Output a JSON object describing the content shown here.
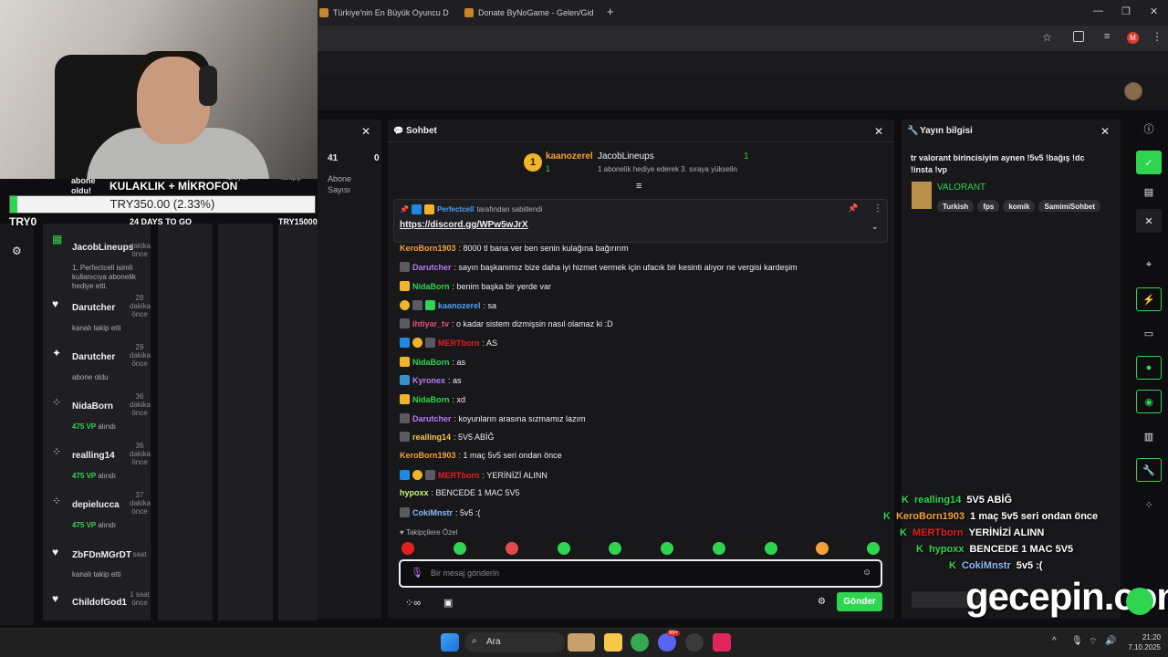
{
  "browser": {
    "tabs": [
      {
        "label": "Türkiye'nin En Büyük Oyuncu D"
      },
      {
        "label": "Donate ByNoGame - Gelen/Gid"
      }
    ],
    "new_tab": "+"
  },
  "dashboard": {
    "stats_count_1": "41",
    "stats_label_1": "Abone Sayısı",
    "stats_count_2": "0",
    "col_label_1": "İzleyici",
    "col_label_2": "Takipçi",
    "abone_oldu": "abone oldu!",
    "try_goal": "TRY15000",
    "goal_title": "KULAKLIK + MİKROFON",
    "goal_amount": "TRY350.00 (2.33%)",
    "goal_left": "TRY0",
    "goal_days": "24 DAYS TO GO",
    "goal_progress": 0.0233
  },
  "activity_feed": [
    {
      "name": "JacobLineups",
      "time": "dakika önce",
      "sub": "1, Perfectcell isimli kullanıcıya abonelik hediye etti."
    },
    {
      "name": "Darutcher",
      "time": "28 dakika önce",
      "sub": "kanalı takip etti"
    },
    {
      "name": "Darutcher",
      "time": "29 dakika önce",
      "sub": "abone oldu"
    },
    {
      "name": "NidaBorn",
      "time": "36 dakika önce",
      "vp": "475 VP",
      "vp_suffix": "alındı"
    },
    {
      "name": "realling14",
      "time": "36 dakika önce",
      "vp": "475 VP",
      "vp_suffix": "alındı"
    },
    {
      "name": "depielucca",
      "time": "37 dakika önce",
      "vp": "475 VP",
      "vp_suffix": "alındı"
    },
    {
      "name": "ZbFDnMGrDT",
      "time": "saat",
      "sub": "kanalı takip etti"
    },
    {
      "name": "ChildofGod1",
      "time": "1 saat önce",
      "sub": ""
    }
  ],
  "chat": {
    "title": "Sohbet",
    "gift_top": {
      "user": "kaanozerel",
      "count": "1",
      "gifter": "JacobLineups",
      "gift_count": "1",
      "gift_text": "1 abonelik hediye ederek 3. sıraya yükselin"
    },
    "pinned": {
      "by": "Perfectcell",
      "by_suffix": "tarafından sabitlendi",
      "link": "https://discord.gg/WPw5wJrX"
    },
    "messages": [
      {
        "user": "KeroBorn1903",
        "color": "#f5a13a",
        "text": ": 8000 tl bana ver ben senin kulağına bağırırım"
      },
      {
        "user": "Darutcher",
        "color": "#b67cf5",
        "text": ": sayın başkanımız bize daha iyi hizmet vermek için ufacık bir kesinti alıyor ne vergisi kardeşim"
      },
      {
        "user": "NidaBorn",
        "color": "#2fd451",
        "text": ": benim başka bir yerde var"
      },
      {
        "user": "kaanozerel",
        "color": "#4aa0f5",
        "text": ": sa"
      },
      {
        "user": "ihtiyar_tv",
        "color": "#f04a7c",
        "text": ": o kadar sistem dizmişsin nasıl olamaz ki :D"
      },
      {
        "user": "MERTborn",
        "color": "#e02020",
        "text": ": AS"
      },
      {
        "user": "NidaBorn",
        "color": "#2fd451",
        "text": ": as"
      },
      {
        "user": "Kyronex",
        "color": "#b67cf5",
        "text": ": as"
      },
      {
        "user": "NidaBorn",
        "color": "#2fd451",
        "text": ": xd"
      },
      {
        "user": "Darutcher",
        "color": "#b67cf5",
        "text": ": koyunların arasına sızmamız lazım"
      },
      {
        "user": "realling14",
        "color": "#f5c84a",
        "text": ": 5V5 ABİĞ"
      },
      {
        "user": "KeroBorn1903",
        "color": "#f5a13a",
        "text": ": 1 maç 5v5 seri ondan önce"
      },
      {
        "user": "MERTborn",
        "color": "#e02020",
        "text": ": YERİNİZİ ALINN"
      },
      {
        "user": "hypoxx",
        "color": "#c6f57a",
        "text": ": BENCEDE 1 MAC 5V5"
      },
      {
        "user": "CokiMnstr",
        "color": "#8fb8f5",
        "text": ": 5v5 :("
      }
    ],
    "follower_only": "Takipçilere Özel",
    "input_placeholder": "Bir mesaj gönderin",
    "send_label": "Gönder"
  },
  "stream_info": {
    "title": "Yayın bilgisi",
    "stream_title": "tr valorant birincisiyim aynen !5v5 !bağış !dc !insta !vp",
    "game": "VALORANT",
    "tags": [
      "Turkish",
      "fps",
      "komik",
      "SamimiSohbet"
    ]
  },
  "overlay_chat": [
    {
      "user": "realling14",
      "color": "#2fd451",
      "text": "5V5 ABİĞ"
    },
    {
      "user": "KeroBorn1903",
      "color": "#f5a13a",
      "text": "1 maç 5v5 seri ondan önce"
    },
    {
      "user": "MERTborn",
      "color": "#e02020",
      "text": "YERİNİZİ ALINN"
    },
    {
      "user": "hypoxx",
      "color": "#2fd451",
      "text": "BENCEDE 1 MAC 5V5"
    },
    {
      "user": "CokiMnstr",
      "color": "#8fb8f5",
      "text": "5v5 :("
    }
  ],
  "watermark": "gecepin.com",
  "taskbar": {
    "search_label": "Ara",
    "time": "21:20",
    "date": "7.10.2025",
    "badge": "99+"
  },
  "colors": {
    "accent": "#2fd451",
    "bg": "#0e0e10",
    "panel": "#18181b"
  }
}
